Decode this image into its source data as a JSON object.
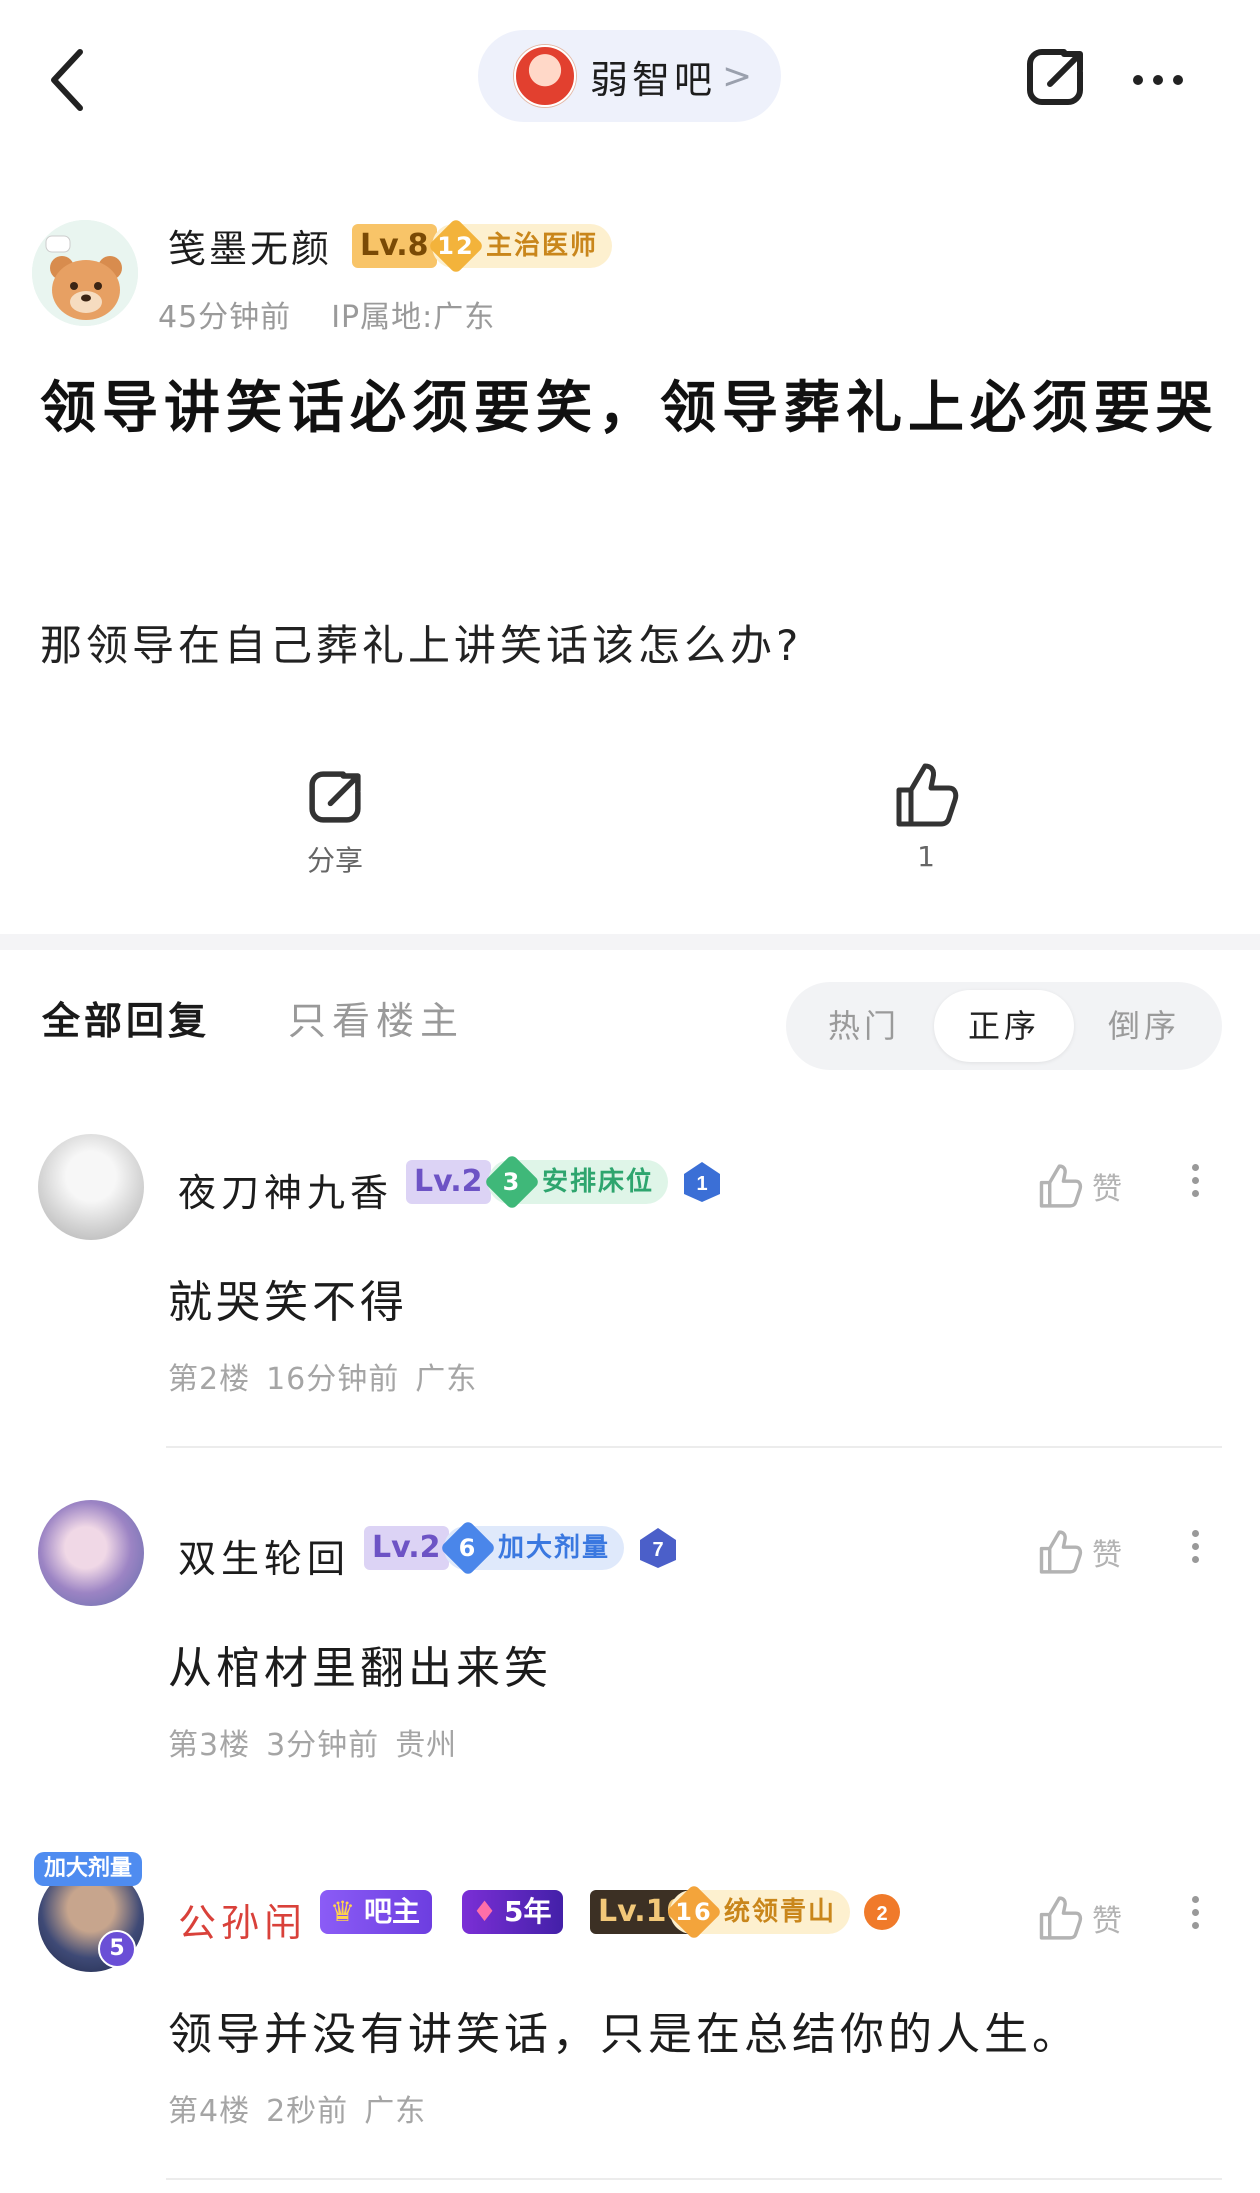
{
  "header": {
    "forum_name": "弱智吧",
    "forum_chevron": ">"
  },
  "post": {
    "author": {
      "name": "笺墨无颜",
      "level": "Lv.8",
      "badge_num": "12",
      "badge_title": "主治医师",
      "time": "45分钟前",
      "ip": "IP属地:广东"
    },
    "title": "领导讲笑话必须要笑，领导葬礼上必须要哭",
    "body": "那领导在自己葬礼上讲笑话该怎么办?",
    "share_label": "分享",
    "like_count": "1"
  },
  "tabs": {
    "all": "全部回复",
    "op_only": "只看楼主"
  },
  "sort": {
    "hot": "热门",
    "asc": "正序",
    "desc": "倒序"
  },
  "replies": [
    {
      "name": "夜刀神九香",
      "level": "Lv.2",
      "badge_num": "3",
      "badge_title": "安排床位",
      "medal": "1",
      "text": "就哭笑不得",
      "floor": "第2楼",
      "time": "16分钟前",
      "place": "广东",
      "like_label": "赞"
    },
    {
      "name": "双生轮回",
      "level": "Lv.2",
      "badge_num": "6",
      "badge_title": "加大剂量",
      "medal": "7",
      "text": "从棺材里翻出来笑",
      "floor": "第3楼",
      "time": "3分钟前",
      "place": "贵州",
      "like_label": "赞"
    },
    {
      "name": "公孙闬",
      "role": "吧主",
      "years": "5年",
      "level": "Lv.10",
      "badge_num": "16",
      "badge_title": "统领青山",
      "medal": "2",
      "avatar_banner": "加大剂量",
      "avatar_badge": "5",
      "text": "领导并没有讲笑话，只是在总结你的人生。",
      "floor": "第4楼",
      "time": "2秒前",
      "place": "广东",
      "like_label": "赞"
    }
  ],
  "colors": {
    "accent_red": "#d9413a",
    "tag_orange": "#c9861b",
    "tag_green": "#2ea56e",
    "tag_blue": "#3a78e0"
  }
}
